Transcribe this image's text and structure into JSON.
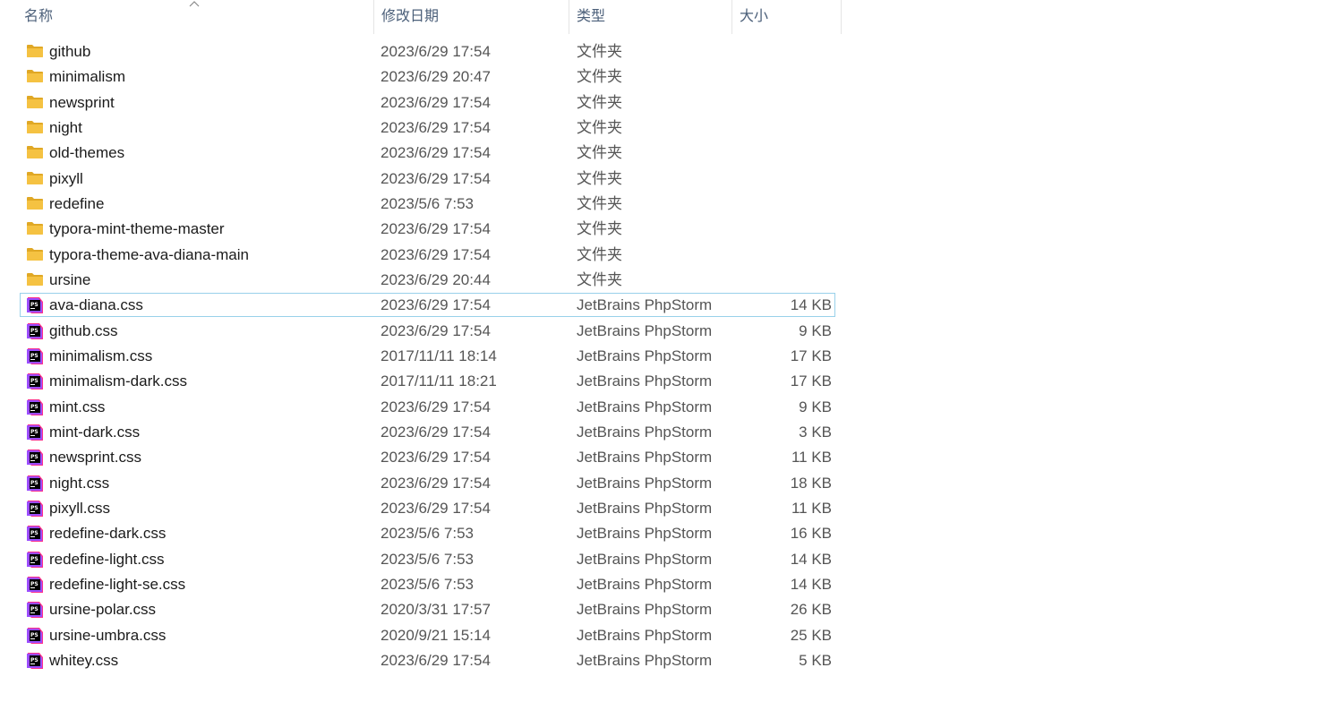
{
  "columns": {
    "name": "名称",
    "date": "修改日期",
    "type": "类型",
    "size": "大小"
  },
  "colors": {
    "folder": "#f5c242",
    "folder_dark": "#e0a825",
    "phpstorm_bg": "#9b4dff",
    "phpstorm_pink": "#ff318c",
    "selection_border": "#99d1ea",
    "header_text": "#4c607a"
  },
  "rows": [
    {
      "icon": "folder-icon",
      "name": "github",
      "date": "2023/6/29 17:54",
      "type": "文件夹",
      "size": ""
    },
    {
      "icon": "folder-icon",
      "name": "minimalism",
      "date": "2023/6/29 20:47",
      "type": "文件夹",
      "size": ""
    },
    {
      "icon": "folder-icon",
      "name": "newsprint",
      "date": "2023/6/29 17:54",
      "type": "文件夹",
      "size": ""
    },
    {
      "icon": "folder-icon",
      "name": "night",
      "date": "2023/6/29 17:54",
      "type": "文件夹",
      "size": ""
    },
    {
      "icon": "folder-icon",
      "name": "old-themes",
      "date": "2023/6/29 17:54",
      "type": "文件夹",
      "size": ""
    },
    {
      "icon": "folder-icon",
      "name": "pixyll",
      "date": "2023/6/29 17:54",
      "type": "文件夹",
      "size": ""
    },
    {
      "icon": "folder-icon",
      "name": "redefine",
      "date": "2023/5/6 7:53",
      "type": "文件夹",
      "size": ""
    },
    {
      "icon": "folder-icon",
      "name": "typora-mint-theme-master",
      "date": "2023/6/29 17:54",
      "type": "文件夹",
      "size": ""
    },
    {
      "icon": "folder-icon",
      "name": "typora-theme-ava-diana-main",
      "date": "2023/6/29 17:54",
      "type": "文件夹",
      "size": ""
    },
    {
      "icon": "folder-icon",
      "name": "ursine",
      "date": "2023/6/29 20:44",
      "type": "文件夹",
      "size": ""
    },
    {
      "icon": "phpstorm-file-icon",
      "name": "ava-diana.css",
      "date": "2023/6/29 17:54",
      "type": "JetBrains PhpStorm",
      "size": "14 KB",
      "selected": true
    },
    {
      "icon": "phpstorm-file-icon",
      "name": "github.css",
      "date": "2023/6/29 17:54",
      "type": "JetBrains PhpStorm",
      "size": "9 KB"
    },
    {
      "icon": "phpstorm-file-icon",
      "name": "minimalism.css",
      "date": "2017/11/11 18:14",
      "type": "JetBrains PhpStorm",
      "size": "17 KB"
    },
    {
      "icon": "phpstorm-file-icon",
      "name": "minimalism-dark.css",
      "date": "2017/11/11 18:21",
      "type": "JetBrains PhpStorm",
      "size": "17 KB"
    },
    {
      "icon": "phpstorm-file-icon",
      "name": "mint.css",
      "date": "2023/6/29 17:54",
      "type": "JetBrains PhpStorm",
      "size": "9 KB"
    },
    {
      "icon": "phpstorm-file-icon",
      "name": "mint-dark.css",
      "date": "2023/6/29 17:54",
      "type": "JetBrains PhpStorm",
      "size": "3 KB"
    },
    {
      "icon": "phpstorm-file-icon",
      "name": "newsprint.css",
      "date": "2023/6/29 17:54",
      "type": "JetBrains PhpStorm",
      "size": "11 KB"
    },
    {
      "icon": "phpstorm-file-icon",
      "name": "night.css",
      "date": "2023/6/29 17:54",
      "type": "JetBrains PhpStorm",
      "size": "18 KB"
    },
    {
      "icon": "phpstorm-file-icon",
      "name": "pixyll.css",
      "date": "2023/6/29 17:54",
      "type": "JetBrains PhpStorm",
      "size": "11 KB"
    },
    {
      "icon": "phpstorm-file-icon",
      "name": "redefine-dark.css",
      "date": "2023/5/6 7:53",
      "type": "JetBrains PhpStorm",
      "size": "16 KB"
    },
    {
      "icon": "phpstorm-file-icon",
      "name": "redefine-light.css",
      "date": "2023/5/6 7:53",
      "type": "JetBrains PhpStorm",
      "size": "14 KB"
    },
    {
      "icon": "phpstorm-file-icon",
      "name": "redefine-light-se.css",
      "date": "2023/5/6 7:53",
      "type": "JetBrains PhpStorm",
      "size": "14 KB"
    },
    {
      "icon": "phpstorm-file-icon",
      "name": "ursine-polar.css",
      "date": "2020/3/31 17:57",
      "type": "JetBrains PhpStorm",
      "size": "26 KB"
    },
    {
      "icon": "phpstorm-file-icon",
      "name": "ursine-umbra.css",
      "date": "2020/9/21 15:14",
      "type": "JetBrains PhpStorm",
      "size": "25 KB"
    },
    {
      "icon": "phpstorm-file-icon",
      "name": "whitey.css",
      "date": "2023/6/29 17:54",
      "type": "JetBrains PhpStorm",
      "size": "5 KB"
    }
  ]
}
